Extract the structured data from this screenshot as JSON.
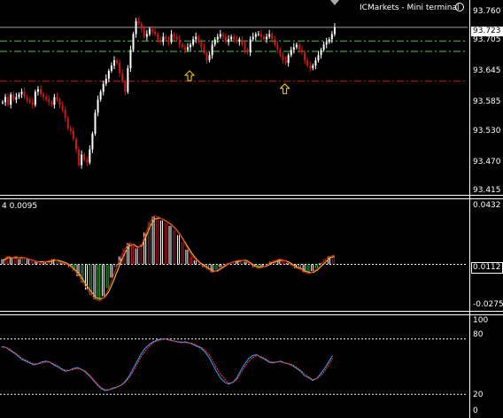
{
  "window": {
    "title": "ICMarkets - Mini terminal"
  },
  "main_pane": {
    "current_price_label": "93.723"
  },
  "macd_pane": {
    "label": "4 0.0095",
    "current_label": "0.0112"
  },
  "stoch_pane": {},
  "colors": {
    "background": "#000000",
    "bull_candle": "#ffffff",
    "bear_candle": "#cc1818",
    "level_green": "#3ccd3c",
    "level_red": "#cc1818",
    "arrow": "#ffd700",
    "hist_positive": "#b01a2a",
    "hist_negative": "#2fae3a",
    "signal_line": "#e0b020",
    "stoch_main": "#3aa0ff",
    "stoch_signal": "#ff4040"
  },
  "chart_data": [
    {
      "type": "candlestick",
      "y_ticks": [
        "93.760",
        "93.705",
        "93.645",
        "93.585",
        "93.530",
        "93.470",
        "93.415"
      ],
      "ylim": [
        93.41,
        93.765
      ],
      "current_price": 93.723,
      "horizontal_levels": [
        {
          "value": 93.723,
          "style": "solid",
          "color": "#9a9a9a"
        },
        {
          "value": 93.697,
          "style": "dash-dot",
          "color": "#3ccd3c"
        },
        {
          "value": 93.677,
          "style": "dash-dot",
          "color": "#3ccd3c"
        },
        {
          "value": 93.62,
          "style": "dash-dot",
          "color": "#cc1818"
        }
      ],
      "up_arrows": [
        {
          "bar": 69,
          "value": 93.64
        },
        {
          "bar": 104,
          "value": 93.615
        }
      ],
      "closes": [
        93.58,
        93.59,
        93.575,
        93.595,
        93.585,
        93.59,
        93.595,
        93.6,
        93.59,
        93.585,
        93.58,
        93.575,
        93.6,
        93.605,
        93.595,
        93.59,
        93.585,
        93.58,
        93.575,
        93.59,
        93.585,
        93.575,
        93.565,
        93.55,
        93.53,
        93.525,
        93.51,
        93.49,
        93.46,
        93.48,
        93.47,
        93.465,
        93.49,
        93.52,
        93.56,
        93.585,
        93.6,
        93.615,
        93.625,
        93.64,
        93.65,
        93.66,
        93.655,
        93.635,
        93.62,
        93.6,
        93.645,
        93.68,
        93.71,
        93.735,
        93.73,
        93.72,
        93.705,
        93.71,
        93.72,
        93.715,
        93.71,
        93.7,
        93.695,
        93.705,
        93.7,
        93.695,
        93.71,
        93.705,
        93.7,
        93.69,
        93.685,
        93.68,
        93.685,
        93.69,
        93.7,
        93.705,
        93.695,
        93.685,
        93.675,
        93.66,
        93.67,
        93.69,
        93.7,
        93.705,
        93.71,
        93.705,
        93.695,
        93.7,
        93.705,
        93.7,
        93.695,
        93.7,
        93.69,
        93.68,
        93.675,
        93.7,
        93.705,
        93.71,
        93.71,
        93.705,
        93.7,
        93.705,
        93.71,
        93.7,
        93.69,
        93.68,
        93.67,
        93.66,
        93.655,
        93.67,
        93.68,
        93.685,
        93.69,
        93.68,
        93.675,
        93.66,
        93.65,
        93.645,
        93.65,
        93.66,
        93.67,
        93.68,
        93.69,
        93.695,
        93.7,
        93.71,
        93.723
      ]
    },
    {
      "type": "histogram",
      "y_ticks": [
        "0.0432",
        "0.0112",
        "-0.0275"
      ],
      "ylim": [
        -0.033,
        0.047
      ],
      "values": [
        0.004,
        0.006,
        0.005,
        0.006,
        0.004,
        0.005,
        0.004,
        0.003,
        0.002,
        0.001,
        0.002,
        0.003,
        0.004,
        0.002,
        0.001,
        0.0,
        -0.002,
        -0.005,
        -0.009,
        -0.014,
        -0.019,
        -0.023,
        -0.026,
        -0.027,
        -0.024,
        -0.018,
        -0.01,
        -0.002,
        0.006,
        0.012,
        0.016,
        0.014,
        0.012,
        0.015,
        0.024,
        0.032,
        0.036,
        0.035,
        0.033,
        0.031,
        0.029,
        0.026,
        0.022,
        0.017,
        0.011,
        0.006,
        0.003,
        0.0,
        -0.002,
        -0.004,
        -0.006,
        -0.004,
        -0.002,
        0.0,
        0.001,
        0.002,
        0.003,
        0.003,
        0.002,
        0.0,
        -0.002,
        -0.003,
        -0.002,
        0.0,
        0.002,
        0.003,
        0.004,
        0.003,
        0.001,
        -0.001,
        -0.003,
        -0.004,
        -0.006,
        -0.007,
        -0.005,
        -0.003,
        0.001,
        0.004,
        0.006,
        0.007
      ],
      "signal": [
        0.003,
        0.005,
        0.005,
        0.005,
        0.005,
        0.005,
        0.004,
        0.003,
        0.002,
        0.002,
        0.002,
        0.002,
        0.003,
        0.003,
        0.002,
        0.001,
        -0.001,
        -0.004,
        -0.007,
        -0.012,
        -0.017,
        -0.021,
        -0.025,
        -0.026,
        -0.025,
        -0.021,
        -0.014,
        -0.006,
        0.002,
        0.009,
        0.014,
        0.015,
        0.013,
        0.014,
        0.021,
        0.029,
        0.034,
        0.035,
        0.034,
        0.032,
        0.03,
        0.027,
        0.023,
        0.018,
        0.013,
        0.008,
        0.004,
        0.001,
        -0.001,
        -0.003,
        -0.005,
        -0.005,
        -0.003,
        -0.001,
        0.001,
        0.002,
        0.002,
        0.003,
        0.003,
        0.001,
        -0.001,
        -0.002,
        -0.002,
        -0.001,
        0.001,
        0.002,
        0.003,
        0.003,
        0.002,
        0.0,
        -0.002,
        -0.003,
        -0.005,
        -0.006,
        -0.006,
        -0.004,
        -0.001,
        0.002,
        0.005,
        0.006
      ]
    },
    {
      "type": "line",
      "y_ticks": [
        "100",
        "80",
        "20",
        "0"
      ],
      "ylim": [
        0,
        100
      ],
      "levels": [
        80,
        20
      ],
      "series": [
        {
          "values": [
            72,
            71,
            68,
            65,
            62,
            58,
            56,
            54,
            52,
            53,
            55,
            56,
            55,
            52,
            50,
            47,
            45,
            46,
            48,
            49,
            47,
            44,
            40,
            35,
            30,
            26,
            24,
            25,
            27,
            28,
            30,
            34,
            40,
            48,
            56,
            64,
            70,
            74,
            77,
            79,
            80,
            80,
            79,
            78,
            77,
            76,
            77,
            76,
            74,
            72,
            70,
            66,
            60,
            52,
            44,
            37,
            33,
            31,
            33,
            38,
            46,
            53,
            59,
            62,
            63,
            60,
            58,
            55,
            54,
            55,
            56,
            54,
            53,
            51,
            48,
            45,
            40,
            38,
            35,
            37,
            42,
            48,
            55,
            62
          ]
        },
        {
          "values": [
            71,
            71,
            69,
            66,
            63,
            59,
            57,
            55,
            53,
            53,
            54,
            55,
            55,
            53,
            51,
            48,
            46,
            46,
            47,
            48,
            47,
            45,
            41,
            36,
            31,
            27,
            25,
            25,
            26,
            28,
            30,
            33,
            38,
            45,
            53,
            61,
            67,
            72,
            76,
            78,
            79,
            80,
            79,
            78,
            77,
            77,
            76,
            76,
            75,
            73,
            71,
            68,
            63,
            56,
            48,
            41,
            36,
            32,
            33,
            36,
            43,
            50,
            56,
            60,
            62,
            61,
            59,
            56,
            55,
            55,
            55,
            54,
            53,
            52,
            49,
            46,
            42,
            39,
            36,
            37,
            40,
            45,
            52,
            59
          ]
        }
      ]
    }
  ]
}
